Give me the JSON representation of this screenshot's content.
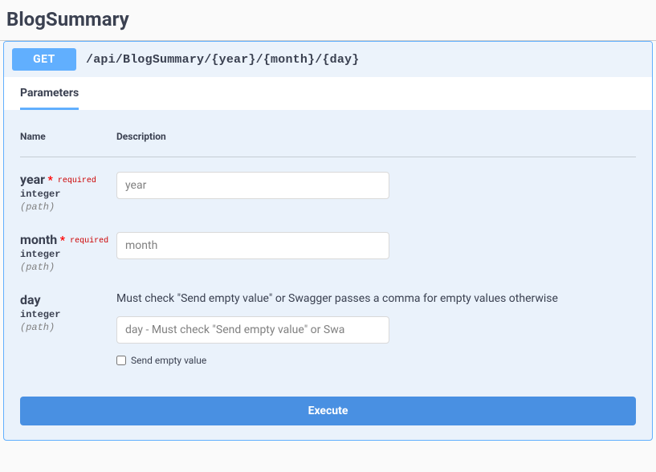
{
  "title": "BlogSummary",
  "operation": {
    "method": "GET",
    "path": "/api/BlogSummary/{year}/{month}/{day}"
  },
  "tabs": {
    "active": "Parameters"
  },
  "columns": {
    "name": "Name",
    "description": "Description"
  },
  "parameters": [
    {
      "name": "year",
      "required": true,
      "required_label": "required",
      "type": "integer",
      "in": "(path)",
      "description": "",
      "placeholder": "year",
      "has_empty_checkbox": false
    },
    {
      "name": "month",
      "required": true,
      "required_label": "required",
      "type": "integer",
      "in": "(path)",
      "description": "",
      "placeholder": "month",
      "has_empty_checkbox": false
    },
    {
      "name": "day",
      "required": false,
      "required_label": "",
      "type": "integer",
      "in": "(path)",
      "description": "Must check \"Send empty value\" or Swagger passes a comma for empty values otherwise",
      "placeholder": "day - Must check \"Send empty value\" or Swa",
      "has_empty_checkbox": true,
      "empty_label": "Send empty value"
    }
  ],
  "buttons": {
    "execute": "Execute"
  }
}
